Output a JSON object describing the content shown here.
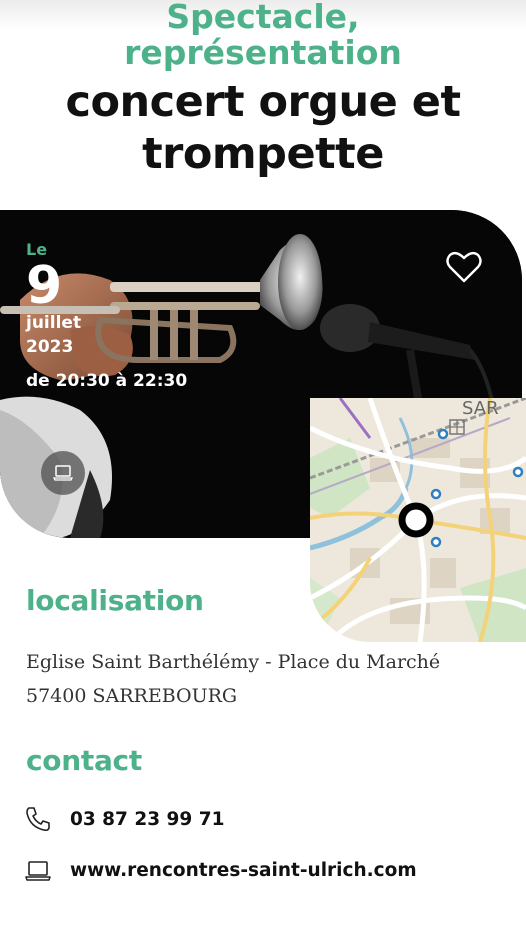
{
  "header": {
    "category_line1": "Spectacle,",
    "category_line2": "représentation",
    "title_line1": "concert orgue et",
    "title_line2": "trompette"
  },
  "hero": {
    "date_prefix": "Le",
    "day": "9",
    "month": "juillet",
    "year": "2023",
    "time": "de 20:30 à 22:30",
    "favorite_icon": "heart-icon",
    "website_icon": "laptop-icon"
  },
  "location": {
    "heading": "localisation",
    "address_line1": "Eglise Saint Barthélémy - Place du Marché",
    "address_line2": "57400 SARREBOURG"
  },
  "contact": {
    "heading": "contact",
    "phone": "03 87 23 99 71",
    "website": "www.rencontres-saint-ulrich.com",
    "phone_icon": "phone-icon",
    "web_icon": "laptop-icon"
  },
  "colors": {
    "accent": "#4db18a",
    "text": "#111111"
  }
}
